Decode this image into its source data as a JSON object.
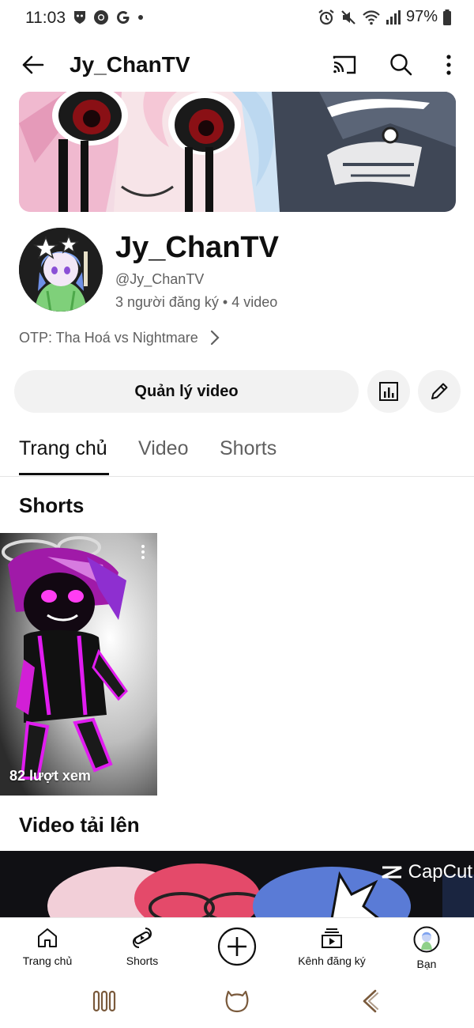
{
  "status_bar": {
    "time": "11:03",
    "battery": "97%"
  },
  "app_bar": {
    "title": "Jy_ChanTV"
  },
  "channel": {
    "name": "Jy_ChanTV",
    "handle": "@Jy_ChanTV",
    "stats": "3 người đăng ký • 4 video",
    "description": "OTP: Tha Hoá vs Nightmare"
  },
  "actions": {
    "manage_label": "Quản lý video"
  },
  "tabs": [
    {
      "label": "Trang chủ",
      "active": true
    },
    {
      "label": "Video",
      "active": false
    },
    {
      "label": "Shorts",
      "active": false
    }
  ],
  "sections": {
    "shorts_title": "Shorts",
    "uploads_title": "Video tải lên"
  },
  "shorts": [
    {
      "views": "82 lượt xem"
    }
  ],
  "videos": [
    {
      "watermark": "CapCut"
    }
  ],
  "bottom_nav": [
    {
      "label": "Trang chủ",
      "icon": "home-icon"
    },
    {
      "label": "Shorts",
      "icon": "shorts-icon"
    },
    {
      "label": "",
      "icon": "create-icon"
    },
    {
      "label": "Kênh đăng ký",
      "icon": "subscriptions-icon"
    },
    {
      "label": "Bạn",
      "icon": "avatar-icon"
    }
  ],
  "colors": {
    "text_primary": "#0f0f0f",
    "text_secondary": "#606060",
    "chip_bg": "#f2f2f2",
    "accent_magenta": "#d21fd6"
  }
}
